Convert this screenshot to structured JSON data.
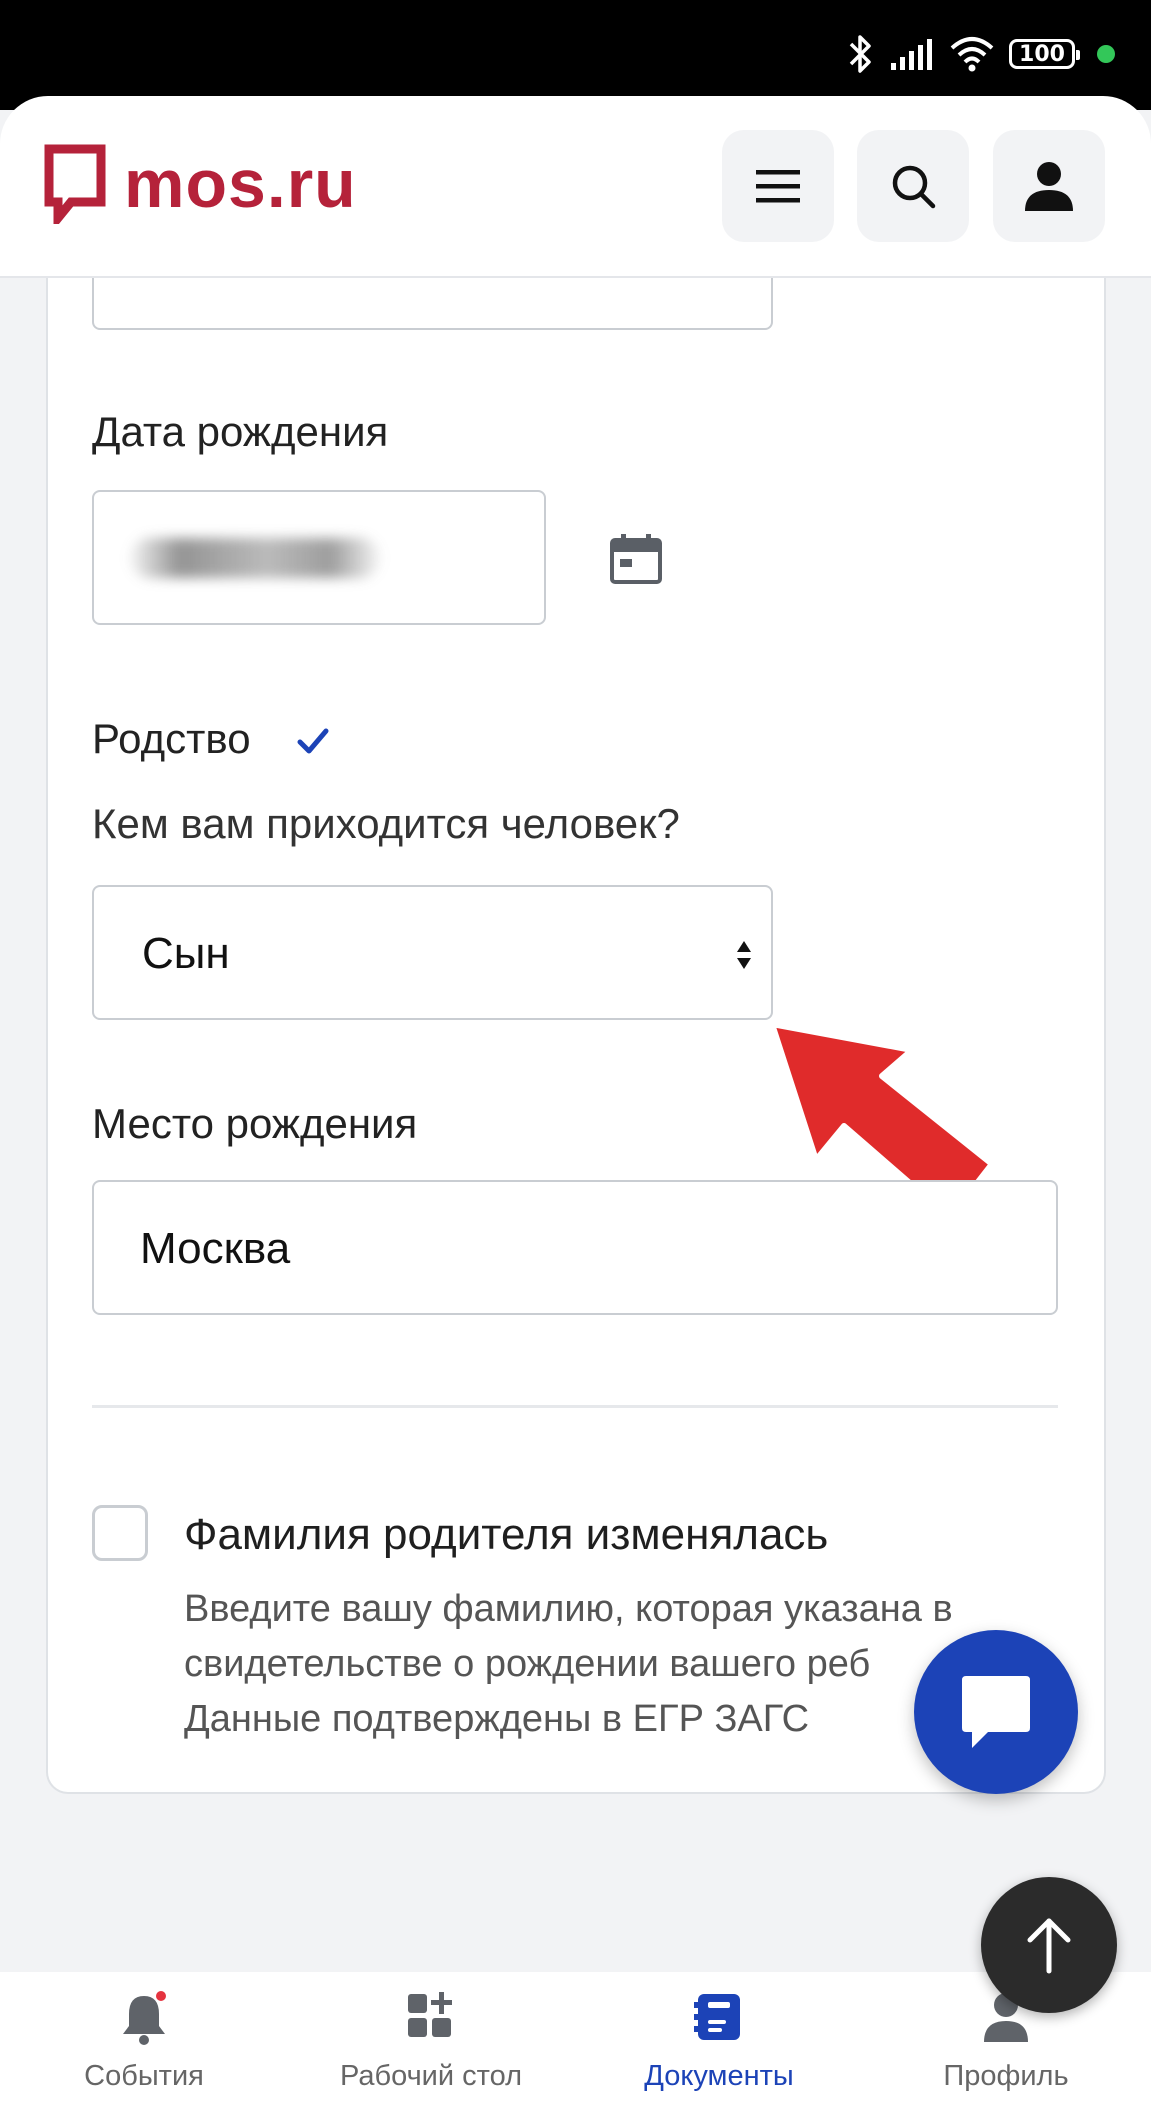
{
  "status_bar": {
    "battery": "100"
  },
  "header": {
    "logo_text": "mos.ru"
  },
  "form": {
    "birth_date_label": "Дата рождения",
    "relationship_label": "Родство",
    "relationship_question": "Кем вам приходится человек?",
    "relationship_value": "Сын",
    "birthplace_label": "Место рождения",
    "birthplace_value": "Москва",
    "surname_changed_label": "Фамилия родителя изменялась",
    "help_lines": [
      "Введите вашу фамилию, которая указана в",
      "свидетельстве о рождении вашего реб",
      "Данные подтверждены в ЕГР ЗАГС"
    ]
  },
  "bottom_nav": {
    "items": [
      {
        "label": "События"
      },
      {
        "label": "Рабочий стол"
      },
      {
        "label": "Документы"
      },
      {
        "label": "Профиль"
      }
    ],
    "active": "Документы"
  },
  "colors": {
    "brand": "#b5223a",
    "accent": "#1c43b7",
    "annotation_arrow": "#e02b2b",
    "notification_dot": "#e5333f"
  }
}
